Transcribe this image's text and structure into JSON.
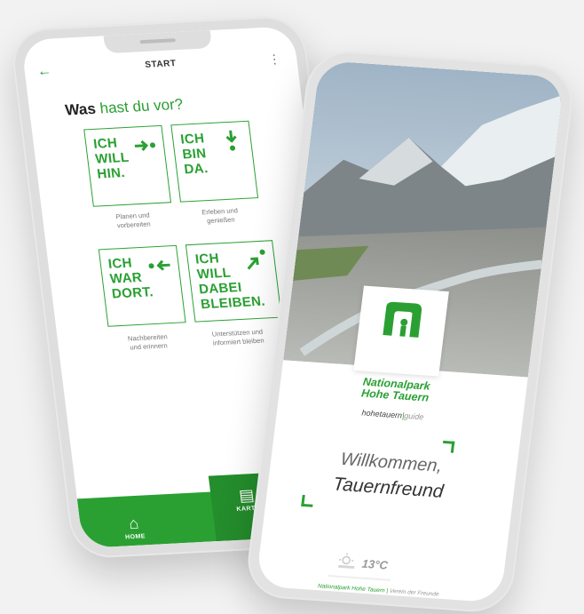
{
  "left_phone": {
    "appbar": {
      "title": "START",
      "back_icon": "arrow-left-icon",
      "more_icon": "more-vert-icon"
    },
    "question": {
      "bold": "Was",
      "green": "hast du vor?"
    },
    "tiles": [
      {
        "text": "ICH\nWILL\nHIN.",
        "icon": "arrow-to-dot-icon",
        "caption": "Planen und\nvorbereiten"
      },
      {
        "text": "ICH\nBIN\nDA.",
        "icon": "arrow-down-dot-icon",
        "caption": "Erleben und\ngenießen"
      },
      {
        "text": "ICH\nWAR\nDORT.",
        "icon": "dot-arrow-left-icon",
        "caption": "Nachbereiten\nund erinnern"
      },
      {
        "text": "ICH\nWILL\nDABEI\nBLEIBEN.",
        "icon": "arrow-diagonal-dot-icon",
        "caption": "Unterstützen und\ninformiert bleiben"
      }
    ],
    "bottom_nav": {
      "home_label": "HOME",
      "karte_label": "KARTE"
    },
    "colors": {
      "accent": "#2aa033"
    }
  },
  "right_phone": {
    "logo_title": "Nationalpark\nHohe Tauern",
    "brand": {
      "main": "hohetauern",
      "sep": "|",
      "light": "guide"
    },
    "welcome_line1": "Willkommen,",
    "welcome_line2": "Tauernfreund",
    "weather": {
      "temp": "13°C",
      "icon": "sun-cloud-icon"
    },
    "footer": {
      "main": "Nationalpark Hohe Tauern",
      "sep": " | ",
      "light": "Verein der Freunde"
    }
  }
}
